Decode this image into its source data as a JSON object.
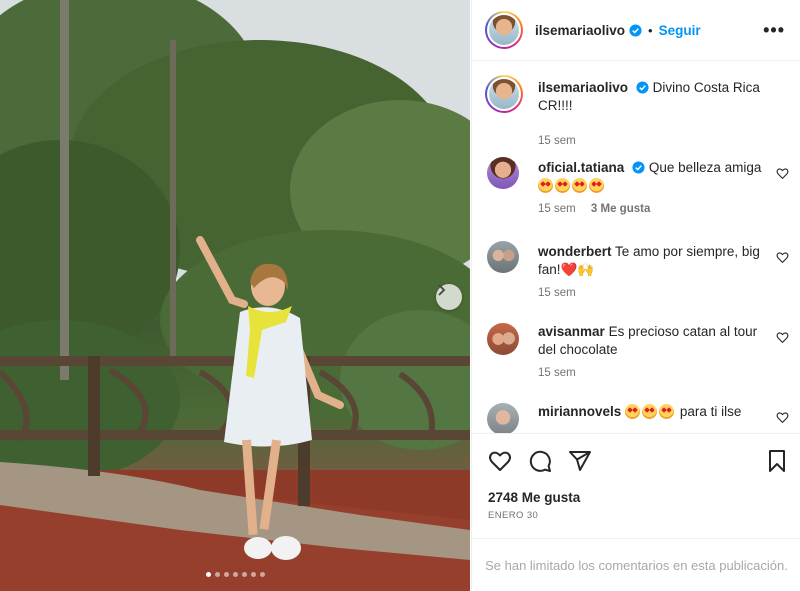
{
  "post": {
    "photo_alt_icon": "carousel-next-icon",
    "carousel_dots": 7,
    "active_dot": 0
  },
  "header": {
    "username": "ilsemariaolivo",
    "separator": "•",
    "follow_label": "Seguir",
    "more_label": "•••"
  },
  "caption": {
    "username": "ilsemariaolivo",
    "text": "Divino Costa Rica",
    "text_line2": "CR!!!!",
    "time": "15 sem"
  },
  "comments": [
    {
      "username": "oficial.tatiana",
      "text": "Que belleza amiga",
      "emoji_count": 4,
      "time": "15 sem",
      "likes": "3 Me gusta"
    },
    {
      "username": "wonderbert",
      "text": "Te amo por siempre, big fan!",
      "emoji_suffix": "❤️🙌",
      "time": "15 sem"
    },
    {
      "username": "avisanmar",
      "text": "Es precioso catan al tour del chocolate",
      "time": "15 sem"
    },
    {
      "username": "miriannovels",
      "emoji_count": 3,
      "text": "para ti ilse"
    }
  ],
  "actions": {
    "likes": "2748 Me gusta",
    "date": "ENERO 30"
  },
  "footer": {
    "limited_text": "Se han limitado los comentarios en esta publicación."
  },
  "colors": {
    "accent": "#0095f6",
    "text": "#262626",
    "muted": "#737373",
    "verified": "#0095f6"
  }
}
